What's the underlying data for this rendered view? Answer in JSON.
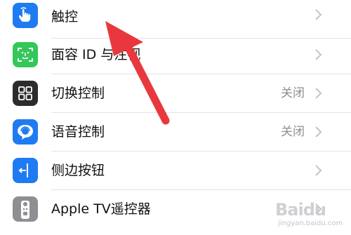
{
  "settings": {
    "rows": [
      {
        "label": "触控",
        "value": "",
        "icon": "touch-hand-icon",
        "icon_color": "#1e7bf2"
      },
      {
        "label": "面容 ID 与注视",
        "value": "",
        "icon": "face-id-icon",
        "icon_color": "#34c759"
      },
      {
        "label": "切换控制",
        "value": "关闭",
        "icon": "switch-control-icon",
        "icon_color": "#2c2c2e"
      },
      {
        "label": "语音控制",
        "value": "关闭",
        "icon": "voice-control-icon",
        "icon_color": "#1e7bf2"
      },
      {
        "label": "侧边按钮",
        "value": "",
        "icon": "side-button-icon",
        "icon_color": "#1e7bf2"
      },
      {
        "label": "Apple TV遥控器",
        "value": "",
        "icon": "apple-tv-remote-icon",
        "icon_color": "#8e8e93"
      }
    ]
  },
  "annotation": {
    "icon": "red-arrow-icon",
    "color": "#e8383d"
  },
  "watermark": {
    "brand": "Baidu",
    "sub": "jingyan.baidu.com"
  }
}
